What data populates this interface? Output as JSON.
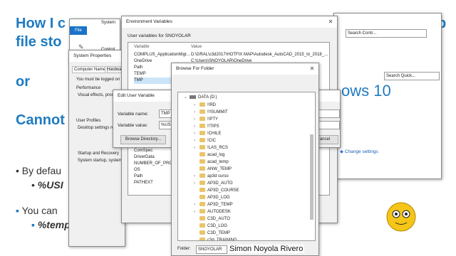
{
  "slide": {
    "title_line1": "How I c",
    "title_line1_right": "p",
    "title_line2": "file sto",
    "or_label": "or",
    "cannot_label": "Cannot",
    "bullet1": "By defau",
    "bullet1_sub": "%USI",
    "bullet2": "You can",
    "bullet2_sub": "%temp%",
    "presenter": "Simon Noyola Rivero",
    "brand_partial": "ows 10"
  },
  "explorer": {
    "search1": "Search Contr...",
    "search2": "Search Quick...",
    "file_tab": "File",
    "system_label": "System",
    "control_label": "Control",
    "change_settings": "Change settings"
  },
  "system_properties": {
    "title": "System Properties",
    "tabs": [
      "Computer Name",
      "Hardwar"
    ],
    "logged_note": "You must be logged on a",
    "performance_label": "Performance",
    "performance_desc": "Visual effects, proc",
    "user_profiles_label": "User Profiles",
    "user_profiles_desc": "Desktop settings rel",
    "startup_label": "Startup and Recovery",
    "startup_desc": "System startup, system f"
  },
  "env_vars": {
    "title": "Environment Variables",
    "user_vars_label": "User variables for SNOYOLAR",
    "col_variable": "Variable",
    "col_value": "Value",
    "rows": [
      {
        "name": "COMPLUS_ApplicationMigr...",
        "value": "D:\\GRAL\\c3d2017\\HOTFIX MAP\\Autodesk_AutoCAD_2015_to_2018_..."
      },
      {
        "name": "OneDrive",
        "value": "C:\\Users\\SNOYOLAR\\OneDrive"
      },
      {
        "name": "Path",
        "value": ""
      },
      {
        "name": "TEMP",
        "value": ""
      },
      {
        "name": "TMP",
        "value": ""
      }
    ],
    "system_rows": [
      "ComSpec",
      "DriverData",
      "NUMBER_OF_PROCES",
      "OS",
      "Path",
      "PATHEXT"
    ],
    "cancel_label": "ancel"
  },
  "edit_user_var": {
    "title": "Edit User Variable",
    "name_label": "Variable name:",
    "name_value": "TMP",
    "value_label": "Variable value:",
    "value_value": "%USE",
    "browse_dir": "Browse Directory..."
  },
  "browse_folder": {
    "title": "Browse For Folder",
    "drive": "DATA (D:)",
    "folders": [
      "!!RD",
      "!!!SUMMIT",
      "!!PTY",
      "!!TIPS",
      "!CHILE",
      "!CIC",
      "!LAS_RCS",
      "acad_log",
      "acad_temp",
      "ANW_TEMP",
      "ap3d curso",
      "AP3D_AUTO",
      "AP3D_COURSE",
      "AP3D_LOG",
      "AP3D_TEMP",
      "AUTODESK",
      "C3D_AUTO",
      "C3D_LOG",
      "C3D_TEMP",
      "c3d_TRAINING"
    ],
    "expandable": [
      true,
      true,
      true,
      true,
      true,
      true,
      true,
      false,
      false,
      false,
      true,
      true,
      false,
      false,
      true,
      true,
      false,
      false,
      false,
      false
    ],
    "folder_label": "Folder:",
    "folder_value": "SNOYOLAR"
  }
}
